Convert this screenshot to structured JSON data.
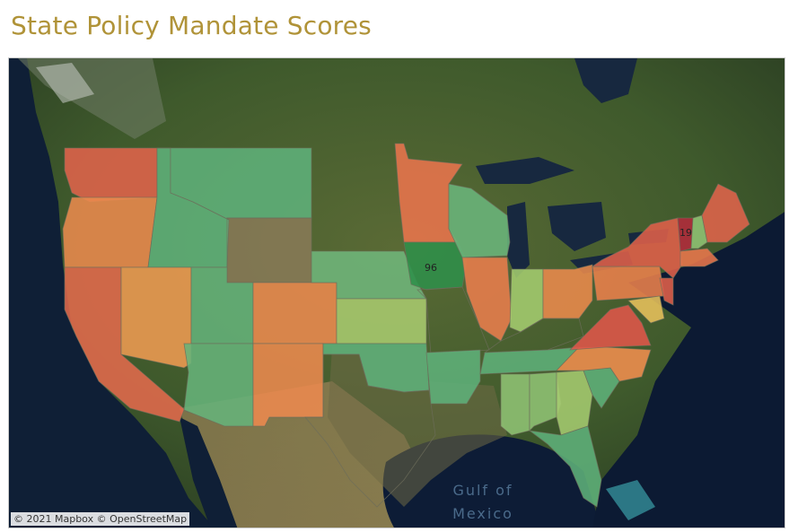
{
  "title": "State Policy Mandate Scores",
  "attribution": "© 2021 Mapbox  © OpenStreetMap",
  "water_labels": {
    "gulf_line1": "Gulf of",
    "gulf_line2": "Mexico"
  },
  "legend_colors": {
    "low": "#b3253a",
    "mid_low": "#e16d4c",
    "mid": "#d7c76a",
    "mid_high": "#7fbf7b",
    "high": "#2a8c4a"
  },
  "states": [
    {
      "id": "WA",
      "color": "#e0634b"
    },
    {
      "id": "OR",
      "color": "#ea8a4d"
    },
    {
      "id": "CA",
      "color": "#e26a4c"
    },
    {
      "id": "ID",
      "color": "#5fb07a"
    },
    {
      "id": "NV",
      "color": "#ee9b52"
    },
    {
      "id": "MT",
      "color": "#5fb07a"
    },
    {
      "id": "WY",
      "color": "#000000"
    },
    {
      "id": "UT",
      "color": "#64b27a"
    },
    {
      "id": "AZ",
      "color": "#66b37a"
    },
    {
      "id": "CO",
      "color": "#ec8a4e"
    },
    {
      "id": "NM",
      "color": "#ec8a4e"
    },
    {
      "id": "NE",
      "color": "#6fb67b"
    },
    {
      "id": "KS",
      "color": "#a9cb6e"
    },
    {
      "id": "OK",
      "color": "#5fb07a"
    },
    {
      "id": "TX",
      "color": "#000000"
    },
    {
      "id": "MN",
      "color": "#e9744c"
    },
    {
      "id": "IA",
      "color": "#2f8f4a",
      "label": "96"
    },
    {
      "id": "MO",
      "color": "#000000"
    },
    {
      "id": "AR",
      "color": "#5fb07a"
    },
    {
      "id": "WI",
      "color": "#6ab57b"
    },
    {
      "id": "IL",
      "color": "#e97d4c"
    },
    {
      "id": "IN",
      "color": "#a4cc6e"
    },
    {
      "id": "OH",
      "color": "#eb8a4c"
    },
    {
      "id": "KY",
      "color": "#000000"
    },
    {
      "id": "TN",
      "color": "#5fb07a"
    },
    {
      "id": "MS",
      "color": "#8fc374"
    },
    {
      "id": "AL",
      "color": "#8fc374"
    },
    {
      "id": "GA",
      "color": "#a5cb6f"
    },
    {
      "id": "FL",
      "color": "#5fb07a"
    },
    {
      "id": "SC",
      "color": "#5fb07a"
    },
    {
      "id": "NC",
      "color": "#f08e4e"
    },
    {
      "id": "VA",
      "color": "#e0574a"
    },
    {
      "id": "PA",
      "color": "#ea814c"
    },
    {
      "id": "NY",
      "color": "#e0604a"
    },
    {
      "id": "VT",
      "color": "#b22a3b",
      "label": "19"
    },
    {
      "id": "NH",
      "color": "#8fc374"
    },
    {
      "id": "ME",
      "color": "#e0634b"
    },
    {
      "id": "MA",
      "color": "#e9764c"
    },
    {
      "id": "NJ",
      "color": "#e0604a"
    },
    {
      "id": "MD",
      "color": "#e8c25c"
    }
  ]
}
